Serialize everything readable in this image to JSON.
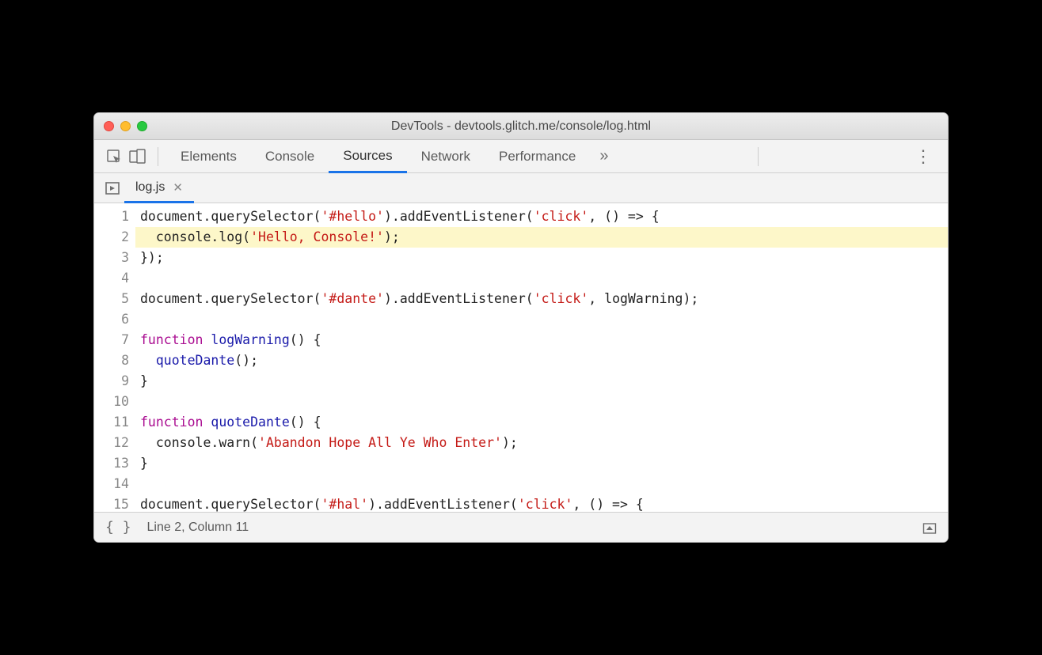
{
  "window_title": "DevTools - devtools.glitch.me/console/log.html",
  "main_tabs": {
    "elements": "Elements",
    "console": "Console",
    "sources": "Sources",
    "network": "Network",
    "performance": "Performance"
  },
  "active_main_tab": "Sources",
  "file_tab": {
    "name": "log.js"
  },
  "code_lines": [
    {
      "n": 1,
      "hl": false,
      "tokens": [
        [
          "",
          "document.querySelector("
        ],
        [
          "str",
          "'#hello'"
        ],
        [
          "",
          "​).addEventListener("
        ],
        [
          "str",
          "'click'"
        ],
        [
          "",
          ", () "
        ],
        [
          "kw",
          "=>"
        ],
        [
          "",
          ""
        ],
        [
          "",
          ""
        ],
        [
          "",
          ""
        ],
        [
          "",
          ""
        ],
        [
          "",
          " {"
        ]
      ],
      "raw": "document.querySelector('#hello').addEventListener('click', () => {"
    },
    {
      "n": 2,
      "hl": true,
      "raw": "  console.log('Hello, Console!');"
    },
    {
      "n": 3,
      "hl": false,
      "raw": "});"
    },
    {
      "n": 4,
      "hl": false,
      "raw": ""
    },
    {
      "n": 5,
      "hl": false,
      "raw": "document.querySelector('#dante').addEventListener('click', logWarning);"
    },
    {
      "n": 6,
      "hl": false,
      "raw": ""
    },
    {
      "n": 7,
      "hl": false,
      "raw": "function logWarning() {"
    },
    {
      "n": 8,
      "hl": false,
      "raw": "  quoteDante();"
    },
    {
      "n": 9,
      "hl": false,
      "raw": "}"
    },
    {
      "n": 10,
      "hl": false,
      "raw": ""
    },
    {
      "n": 11,
      "hl": false,
      "raw": "function quoteDante() {"
    },
    {
      "n": 12,
      "hl": false,
      "raw": "  console.warn('Abandon Hope All Ye Who Enter');"
    },
    {
      "n": 13,
      "hl": false,
      "raw": "}"
    },
    {
      "n": 14,
      "hl": false,
      "raw": ""
    },
    {
      "n": 15,
      "hl": false,
      "raw": "document.querySelector('#hal').addEventListener('click', () => {"
    }
  ],
  "status": {
    "cursor": "Line 2, Column 11"
  }
}
